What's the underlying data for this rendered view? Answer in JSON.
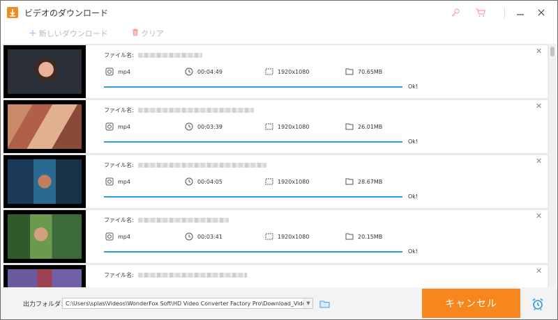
{
  "window": {
    "title": "ビデオのダウンロード",
    "accent_color": "#f7871d",
    "progress_color": "#2d9ae5"
  },
  "title_buttons": {
    "icons": [
      "key-icon",
      "cart-icon",
      "minimize-icon",
      "close-icon"
    ]
  },
  "toolbar": {
    "new_download_label": "新しいダウンロード",
    "clear_label": "クリア"
  },
  "list": {
    "filename_label": "ファイル名:",
    "items": [
      {
        "format": "mp4",
        "duration": "00:04:49",
        "resolution": "1920x1080",
        "size": "70.65MB",
        "status": "Ok!",
        "progress": 1.0
      },
      {
        "format": "mp4",
        "duration": "00:03:39",
        "resolution": "1920x1080",
        "size": "26.01MB",
        "status": "Ok!",
        "progress": 1.0
      },
      {
        "format": "mp4",
        "duration": "00:04:05",
        "resolution": "1920x1080",
        "size": "28.67MB",
        "status": "Ok!",
        "progress": 1.0
      },
      {
        "format": "mp4",
        "duration": "00:03:41",
        "resolution": "1920x1080",
        "size": "20.15MB",
        "status": "Ok!",
        "progress": 1.0
      },
      {
        "format": "",
        "duration": "",
        "resolution": "",
        "size": "",
        "status": "",
        "progress": 0
      }
    ]
  },
  "bottom": {
    "output_folder_label": "出力フォルダ：",
    "output_path": "C:\\Users\\splas\\Videos\\WonderFox Soft\\HD Video Converter Factory Pro\\Download_Video\\",
    "cancel_label": "キャンセル"
  }
}
